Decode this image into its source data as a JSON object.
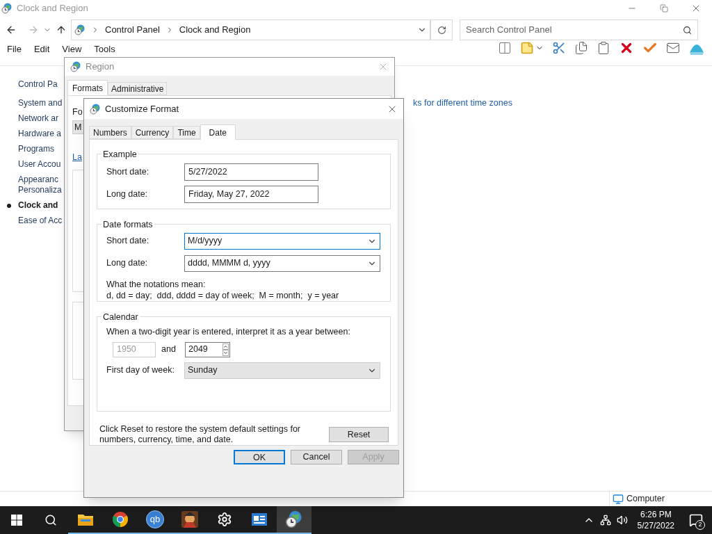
{
  "explorer": {
    "title": "Clock and Region",
    "breadcrumb": [
      "Control Panel",
      "Clock and Region"
    ],
    "search": {
      "placeholder": "Search Control Panel"
    },
    "menu": [
      "File",
      "Edit",
      "View",
      "Tools"
    ],
    "nav": [
      {
        "label": "Control Pa",
        "selected": false
      },
      {
        "label": "System and",
        "selected": false
      },
      {
        "label": "Network ar",
        "selected": false
      },
      {
        "label": "Hardware a",
        "selected": false
      },
      {
        "label": "Programs",
        "selected": false
      },
      {
        "label": "User Accou",
        "selected": false
      },
      {
        "label": "Appearanc\nPersonaliza",
        "selected": false
      },
      {
        "label": "Clock and",
        "selected": true
      },
      {
        "label": "Ease of Acc",
        "selected": false
      }
    ],
    "link": "ks for different time zones",
    "status": "Computer"
  },
  "region_dialog": {
    "title": "Region",
    "tabs": [
      {
        "label": "Formats",
        "selected": true
      },
      {
        "label": "Administrative",
        "selected": false
      }
    ],
    "format_label": "Fo",
    "format_value": "M",
    "link": "La"
  },
  "customize_dialog": {
    "title": "Customize Format",
    "tabs": [
      {
        "label": "Numbers",
        "selected": false
      },
      {
        "label": "Currency",
        "selected": false
      },
      {
        "label": "Time",
        "selected": false
      },
      {
        "label": "Date",
        "selected": true
      }
    ],
    "example": {
      "title": "Example",
      "rows": [
        {
          "label": "Short date:",
          "value": "5/27/2022"
        },
        {
          "label": "Long date:",
          "value": "Friday, May 27, 2022"
        }
      ]
    },
    "date_formats": {
      "title": "Date formats",
      "rows": [
        {
          "label": "Short date:",
          "value": "M/d/yyyy",
          "focused": true
        },
        {
          "label": "Long date:",
          "value": "dddd, MMMM d, yyyy",
          "focused": false
        }
      ],
      "notation_title": "What the notations mean:",
      "notation": "d, dd = day;  ddd, dddd = day of week;  M = month;  y = year"
    },
    "calendar": {
      "title": "Calendar",
      "prompt": "When a two-digit year is entered, interpret it as a year between:",
      "from": {
        "value": "1950",
        "disabled": true
      },
      "and": "and",
      "to": "2049",
      "first_day_label": "First day of week:",
      "first_day": "Sunday"
    },
    "reset_text": "Click Reset to restore the system default settings for numbers, currency, time, and date.",
    "reset": "Reset",
    "buttons": [
      {
        "label": "OK",
        "default": true,
        "disabled": false
      },
      {
        "label": "Cancel",
        "default": false,
        "disabled": false
      },
      {
        "label": "Apply",
        "default": false,
        "disabled": true
      }
    ]
  },
  "taskbar": {
    "apps": [
      {
        "kind": "folder",
        "active": false
      },
      {
        "kind": "chrome",
        "active": false
      },
      {
        "kind": "qb",
        "label": "qb",
        "active": false
      },
      {
        "kind": "game",
        "active": false
      },
      {
        "kind": "settings",
        "active": false
      },
      {
        "kind": "news",
        "active": false
      },
      {
        "kind": "clock",
        "active": true
      }
    ],
    "time": "6:26 PM",
    "date": "5/27/2022",
    "notifications": "2"
  }
}
